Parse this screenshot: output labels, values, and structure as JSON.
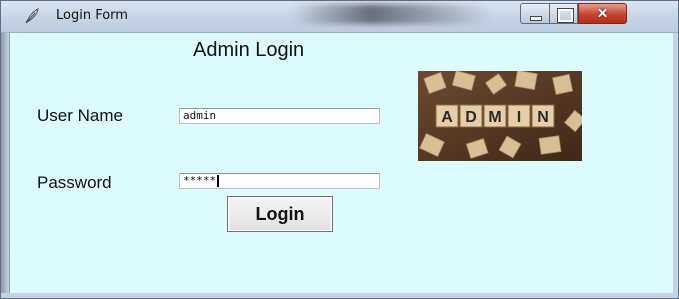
{
  "window": {
    "title": "Login Form",
    "icon": "feather-icon",
    "controls": {
      "minimize": "minimize-icon",
      "maximize": "maximize-icon",
      "close": "✕"
    }
  },
  "form": {
    "heading": "Admin Login",
    "username_label": "User Name",
    "username_value": "admin",
    "password_label": "Password",
    "password_value": "*****",
    "login_button": "Login"
  },
  "image": {
    "letters": [
      "A",
      "D",
      "M",
      "I",
      "N"
    ]
  },
  "colors": {
    "client_background": "#ddfbff",
    "close_button": "#c5452e",
    "tile": "#e6cfa6",
    "image_background": "#5a3b26"
  }
}
